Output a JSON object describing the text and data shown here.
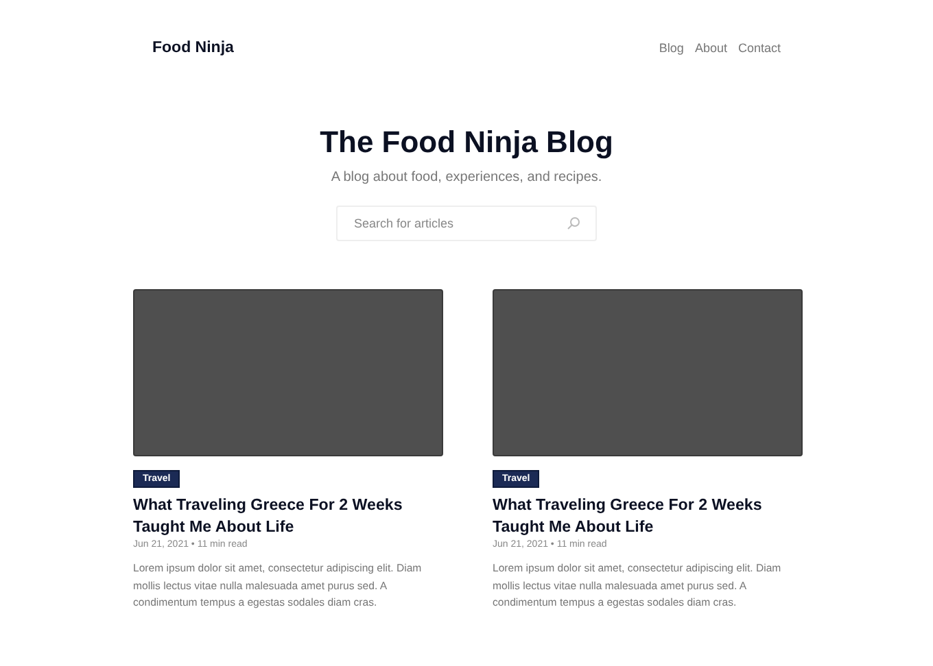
{
  "header": {
    "logo": "Food Ninja",
    "nav": [
      "Blog",
      "About",
      "Contact"
    ]
  },
  "hero": {
    "title": "The Food Ninja Blog",
    "subtitle": "A blog about food, experiences, and recipes.",
    "search": {
      "placeholder": "Search for articles"
    }
  },
  "posts": [
    {
      "tag": "Travel",
      "title": "What Traveling Greece For 2 Weeks Taught Me About Life",
      "meta": "Jun 21, 2021 • 11 min read",
      "excerpt": "Lorem ipsum dolor sit amet, consectetur adipiscing elit. Diam mollis lectus vitae nulla malesuada amet purus sed. A condimentum tempus a egestas sodales diam cras."
    },
    {
      "tag": "Travel",
      "title": "What Traveling Greece For 2 Weeks Taught Me About Life",
      "meta": "Jun 21, 2021 • 11 min read",
      "excerpt": "Lorem ipsum dolor sit amet, consectetur adipiscing elit. Diam mollis lectus vitae nulla malesuada amet purus sed. A condimentum tempus a egestas sodales diam cras."
    }
  ]
}
